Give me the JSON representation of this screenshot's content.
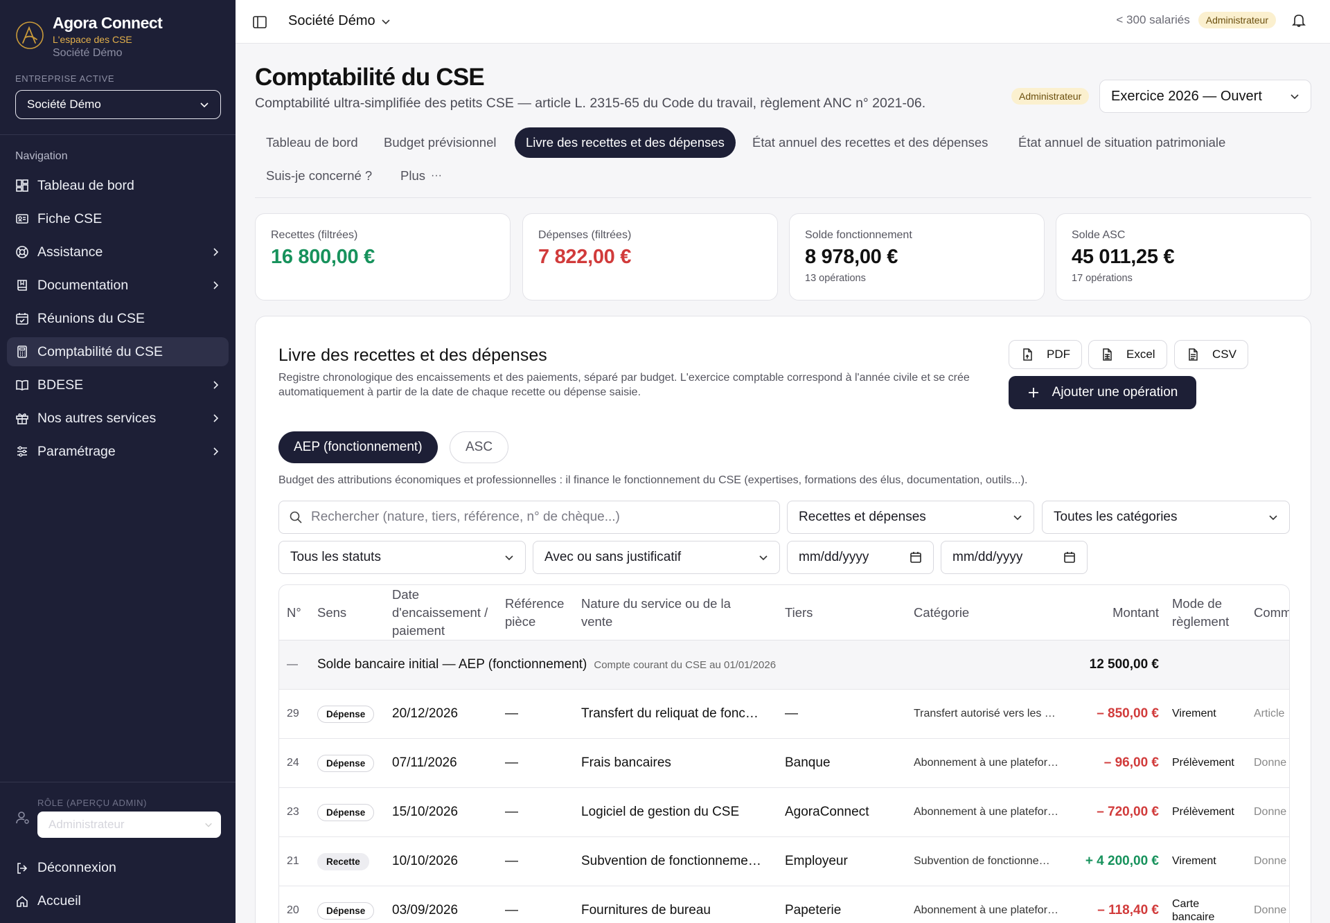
{
  "brand": {
    "name": "Agora Connect",
    "tagline": "L'espace des CSE",
    "company": "Société Démo"
  },
  "sidebar": {
    "entreprise_label": "ENTREPRISE ACTIVE",
    "entreprise_value": "Société Démo",
    "nav_title": "Navigation",
    "items": [
      {
        "label": "Tableau de bord",
        "icon": "dashboard-icon",
        "chevron": false,
        "active": false
      },
      {
        "label": "Fiche CSE",
        "icon": "id-card-icon",
        "chevron": false,
        "active": false
      },
      {
        "label": "Assistance",
        "icon": "lifebuoy-icon",
        "chevron": true,
        "active": false
      },
      {
        "label": "Documentation",
        "icon": "book-icon",
        "chevron": true,
        "active": false
      },
      {
        "label": "Réunions du CSE",
        "icon": "calendar-icon",
        "chevron": false,
        "active": false
      },
      {
        "label": "Comptabilité du CSE",
        "icon": "calculator-icon",
        "chevron": false,
        "active": true
      },
      {
        "label": "BDESE",
        "icon": "open-book-icon",
        "chevron": true,
        "active": false
      },
      {
        "label": "Nos autres services",
        "icon": "gift-icon",
        "chevron": true,
        "active": false
      },
      {
        "label": "Paramétrage",
        "icon": "sliders-icon",
        "chevron": true,
        "active": false
      }
    ],
    "role_label": "RÔLE (APERÇU ADMIN)",
    "role_value": "Administrateur",
    "logout": "Déconnexion",
    "home": "Accueil"
  },
  "topbar": {
    "company": "Société Démo",
    "size": "< 300 salariés",
    "role_badge": "Administrateur"
  },
  "header": {
    "title": "Comptabilité du CSE",
    "subtitle": "Comptabilité ultra-simplifiée des petits CSE — article L. 2315-65 du Code du travail, règlement ANC n° 2021-06.",
    "badge": "Administrateur",
    "exercice": "Exercice 2026 — Ouvert"
  },
  "tabs": [
    {
      "label": "Tableau de bord"
    },
    {
      "label": "Budget prévisionnel"
    },
    {
      "label": "Livre des recettes et des dépenses"
    },
    {
      "label": "État annuel des recettes et des dépenses"
    },
    {
      "label": "État annuel de situation patrimoniale"
    },
    {
      "label": "Suis-je concerné ?"
    },
    {
      "label": "Plus"
    }
  ],
  "cards": [
    {
      "label": "Recettes (filtrées)",
      "value": "16 800,00 €",
      "sub": ""
    },
    {
      "label": "Dépenses (filtrées)",
      "value": "7 822,00 €",
      "sub": ""
    },
    {
      "label": "Solde fonctionnement",
      "value": "8 978,00 €",
      "sub": "13 opérations"
    },
    {
      "label": "Solde ASC",
      "value": "45 011,25 €",
      "sub": "17 opérations"
    }
  ],
  "panel": {
    "title": "Livre des recettes et des dépenses",
    "description": "Registre chronologique des encaissements et des paiements, séparé par budget. L'exercice comptable correspond à l'année civile et se crée automatiquement à partir de la date de chaque recette ou dépense saisie.",
    "export_pdf": "PDF",
    "export_excel": "Excel",
    "export_csv": "CSV",
    "add_button": "Ajouter une opération",
    "seg_aep": "AEP (fonctionnement)",
    "seg_asc": "ASC",
    "seg_desc": "Budget des attributions économiques et professionnelles : il finance le fonctionnement du CSE (expertises, formations des élus, documentation, outils...)."
  },
  "filters": {
    "search_placeholder": "Rechercher (nature, tiers, référence, n° de chèque...)",
    "type": "Recettes et dépenses",
    "category": "Toutes les catégories",
    "status": "Tous les statuts",
    "justif": "Avec ou sans justificatif",
    "date_from": "mm/dd/yyyy",
    "date_to": "mm/dd/yyyy"
  },
  "table": {
    "headers": {
      "num": "N°",
      "sens": "Sens",
      "date": "Date d'encaissement / paiement",
      "ref": "Référence pièce",
      "nature": "Nature du service ou de la vente",
      "tiers": "Tiers",
      "categorie": "Catégorie",
      "montant": "Montant",
      "mode": "Mode de règlement",
      "comment": "Comm"
    },
    "initial": {
      "num": "—",
      "label": "Solde bancaire initial — AEP (fonctionnement)",
      "note": "Compte courant du CSE au 01/01/2026",
      "amount": "12 500,00 €"
    },
    "rows": [
      {
        "num": "29",
        "sens": "Dépense",
        "date": "20/12/2026",
        "ref": "—",
        "nature": "Transfert du reliquat de fonc…",
        "tiers": "—",
        "categorie": "Transfert autorisé vers les …",
        "montant": "– 850,00 €",
        "type": "out",
        "mode": "Virement",
        "comment": "Article"
      },
      {
        "num": "24",
        "sens": "Dépense",
        "date": "07/11/2026",
        "ref": "—",
        "nature": "Frais bancaires",
        "tiers": "Banque",
        "categorie": "Abonnement à une platefor…",
        "montant": "– 96,00 €",
        "type": "out",
        "mode": "Prélèvement",
        "comment": "Donne"
      },
      {
        "num": "23",
        "sens": "Dépense",
        "date": "15/10/2026",
        "ref": "—",
        "nature": "Logiciel de gestion du CSE",
        "tiers": "AgoraConnect",
        "categorie": "Abonnement à une platefor…",
        "montant": "– 720,00 €",
        "type": "out",
        "mode": "Prélèvement",
        "comment": "Donne"
      },
      {
        "num": "21",
        "sens": "Recette",
        "date": "10/10/2026",
        "ref": "—",
        "nature": "Subvention de fonctionneme…",
        "tiers": "Employeur",
        "categorie": "Subvention de fonctionne…",
        "montant": "+ 4 200,00 €",
        "type": "in",
        "mode": "Virement",
        "comment": "Donne"
      },
      {
        "num": "20",
        "sens": "Dépense",
        "date": "03/09/2026",
        "ref": "—",
        "nature": "Fournitures de bureau",
        "tiers": "Papeterie",
        "categorie": "Abonnement à une platefor…",
        "montant": "– 118,40 €",
        "type": "out",
        "mode": "Carte bancaire",
        "comment": "Donne"
      }
    ]
  },
  "colors": {
    "sidebar": "#1d1f36",
    "accent_green": "#17925c",
    "accent_red": "#d13b3b",
    "badge_bg": "#fbf0cf"
  }
}
